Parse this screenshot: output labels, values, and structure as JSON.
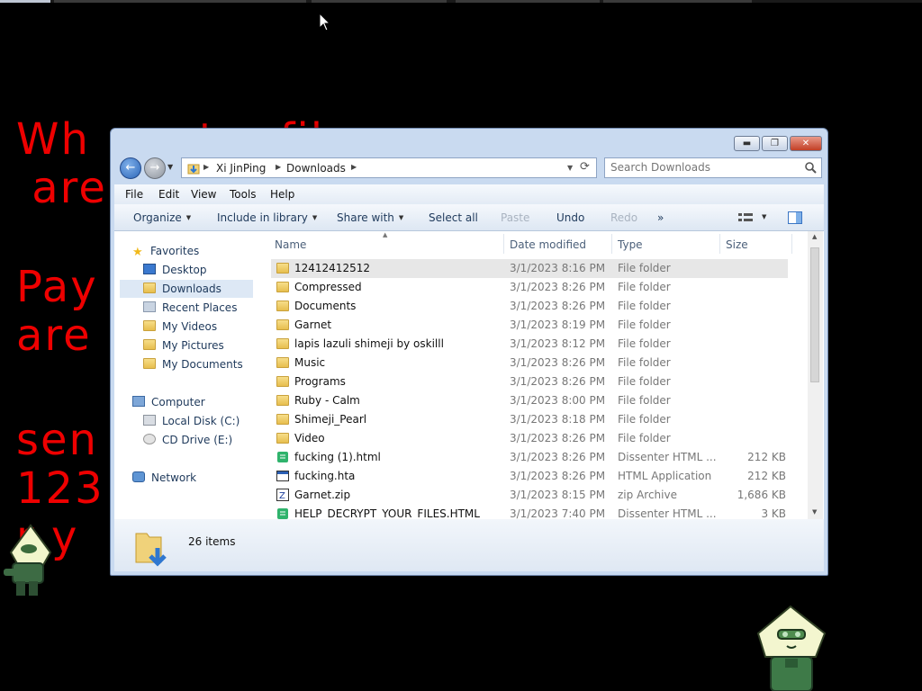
{
  "ransom_lines": [
    "Wh       t    fil",
    " are",
    "",
    "Pay",
    "are",
    "",
    "sen",
    "123",
    "r y"
  ],
  "window": {
    "controls": {
      "minimize": "▬",
      "maximize": "❐",
      "close": "✕"
    }
  },
  "address": {
    "crumbs": [
      "Xi JinPing",
      "Downloads"
    ]
  },
  "search": {
    "placeholder": "Search Downloads"
  },
  "menu": [
    "File",
    "Edit",
    "View",
    "Tools",
    "Help"
  ],
  "toolbar": {
    "organize": "Organize",
    "include": "Include in library",
    "share": "Share with",
    "select_all": "Select all",
    "paste": "Paste",
    "undo": "Undo",
    "redo": "Redo",
    "more": "»"
  },
  "nav": {
    "favorites": "Favorites",
    "desktop": "Desktop",
    "downloads": "Downloads",
    "recent": "Recent Places",
    "videos": "My Videos",
    "pictures": "My Pictures",
    "documents": "My Documents",
    "computer": "Computer",
    "localdisk": "Local Disk (C:)",
    "cddrive": "CD Drive (E:)",
    "network": "Network"
  },
  "columns": {
    "name": "Name",
    "date": "Date modified",
    "type": "Type",
    "size": "Size"
  },
  "files": [
    {
      "name": "12412412512",
      "date": "3/1/2023 8:16 PM",
      "type": "File folder",
      "size": "",
      "icon": "folder"
    },
    {
      "name": "Compressed",
      "date": "3/1/2023 8:26 PM",
      "type": "File folder",
      "size": "",
      "icon": "folder"
    },
    {
      "name": "Documents",
      "date": "3/1/2023 8:26 PM",
      "type": "File folder",
      "size": "",
      "icon": "folder"
    },
    {
      "name": "Garnet",
      "date": "3/1/2023 8:19 PM",
      "type": "File folder",
      "size": "",
      "icon": "folder"
    },
    {
      "name": "lapis lazuli shimeji by oskilll",
      "date": "3/1/2023 8:12 PM",
      "type": "File folder",
      "size": "",
      "icon": "folder"
    },
    {
      "name": "Music",
      "date": "3/1/2023 8:26 PM",
      "type": "File folder",
      "size": "",
      "icon": "folder"
    },
    {
      "name": "Programs",
      "date": "3/1/2023 8:26 PM",
      "type": "File folder",
      "size": "",
      "icon": "folder"
    },
    {
      "name": "Ruby - Calm",
      "date": "3/1/2023 8:00 PM",
      "type": "File folder",
      "size": "",
      "icon": "folder"
    },
    {
      "name": "Shimeji_Pearl",
      "date": "3/1/2023 8:18 PM",
      "type": "File folder",
      "size": "",
      "icon": "folder"
    },
    {
      "name": "Video",
      "date": "3/1/2023 8:26 PM",
      "type": "File folder",
      "size": "",
      "icon": "folder"
    },
    {
      "name": "fucking (1).html",
      "date": "3/1/2023 8:26 PM",
      "type": "Dissenter HTML ...",
      "size": "212 KB",
      "icon": "html"
    },
    {
      "name": "fucking.hta",
      "date": "3/1/2023 8:26 PM",
      "type": "HTML Application",
      "size": "212 KB",
      "icon": "hta"
    },
    {
      "name": "Garnet.zip",
      "date": "3/1/2023 8:15 PM",
      "type": "zip Archive",
      "size": "1,686 KB",
      "icon": "zip"
    },
    {
      "name": "HELP_DECRYPT_YOUR_FILES.HTML",
      "date": "3/1/2023 7:40 PM",
      "type": "Dissenter HTML ...",
      "size": "3 KB",
      "icon": "html"
    }
  ],
  "status": {
    "count": "26 items"
  }
}
